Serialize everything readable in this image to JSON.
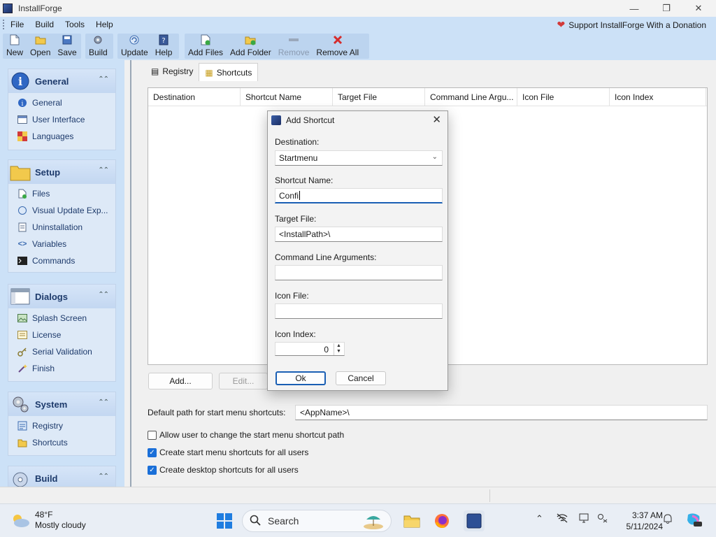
{
  "window": {
    "title": "InstallForge"
  },
  "menu": {
    "items": [
      "File",
      "Build",
      "Tools",
      "Help"
    ],
    "donate": "Support InstallForge With a Donation"
  },
  "toolbar": {
    "new": "New",
    "open": "Open",
    "save": "Save",
    "build": "Build",
    "update": "Update",
    "help": "Help",
    "add_files": "Add Files",
    "add_folder": "Add Folder",
    "remove": "Remove",
    "remove_all": "Remove All"
  },
  "sidebar": {
    "general": {
      "title": "General",
      "items": [
        "General",
        "User Interface",
        "Languages"
      ]
    },
    "setup": {
      "title": "Setup",
      "items": [
        "Files",
        "Visual Update Exp...",
        "Uninstallation",
        "Variables",
        "Commands"
      ]
    },
    "dialogs": {
      "title": "Dialogs",
      "items": [
        "Splash Screen",
        "License",
        "Serial Validation",
        "Finish"
      ]
    },
    "system": {
      "title": "System",
      "items": [
        "Registry",
        "Shortcuts"
      ]
    },
    "build": {
      "title": "Build"
    }
  },
  "tabs": [
    "Registry",
    "Shortcuts"
  ],
  "grid": {
    "columns": [
      "Destination",
      "Shortcut Name",
      "Target File",
      "Command Line Argu...",
      "Icon File",
      "Icon Index"
    ]
  },
  "buttons": {
    "add": "Add...",
    "edit": "Edit..."
  },
  "default_path": {
    "label": "Default path for start menu shortcuts:",
    "value": "<AppName>\\"
  },
  "checks": {
    "allow_change": {
      "label": "Allow user to change the start menu shortcut path",
      "checked": false
    },
    "all_users_start": {
      "label": "Create start menu shortcuts for all users",
      "checked": true
    },
    "all_users_desktop": {
      "label": "Create desktop shortcuts for all users",
      "checked": true
    }
  },
  "dialog": {
    "title": "Add Shortcut",
    "destination_label": "Destination:",
    "destination_value": "Startmenu",
    "name_label": "Shortcut Name:",
    "name_value": "Confi",
    "target_label": "Target File:",
    "target_value": "<InstallPath>\\",
    "args_label": "Command Line Arguments:",
    "args_value": "",
    "icon_file_label": "Icon File:",
    "icon_file_value": "",
    "icon_index_label": "Icon Index:",
    "icon_index_value": "0",
    "ok": "Ok",
    "cancel": "Cancel"
  },
  "taskbar": {
    "temp": "48°F",
    "condition": "Mostly cloudy",
    "search": "Search",
    "time": "3:37 AM",
    "date": "5/11/2024"
  }
}
